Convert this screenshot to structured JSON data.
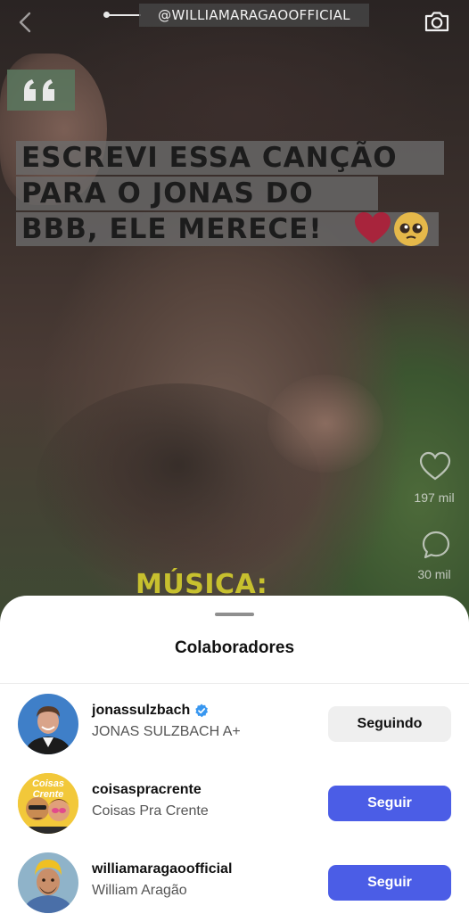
{
  "video": {
    "handle": "@WILLIAMARAGAOOFFICIAL",
    "caption_lines": [
      "ESCREVI ESSA CANÇÃO",
      "PARA O JONAS DO",
      "BBB, ELE MERECE!"
    ],
    "music_text": "MÚSICA: JONAS",
    "likes": "197 mil",
    "comments": "30 mil",
    "icons": {
      "back": "chevron-left-icon",
      "camera": "camera-icon",
      "like": "heart-outline-icon",
      "comment": "speech-bubble-icon",
      "quote": "quote-icon"
    },
    "emojis": [
      "heart-emoji",
      "pleading-face-emoji"
    ]
  },
  "sheet": {
    "title": "Colaboradores",
    "collaborators": [
      {
        "username": "jonassulzbach",
        "display_name": "JONAS SULZBACH A+",
        "verified": true,
        "button": "Seguindo",
        "button_state": "following"
      },
      {
        "username": "coisaspracrente",
        "display_name": "Coisas Pra Crente",
        "verified": false,
        "button": "Seguir",
        "button_state": "follow",
        "avatar_text": "Coisas Crente"
      },
      {
        "username": "williamaragaoofficial",
        "display_name": "William Aragão",
        "verified": false,
        "button": "Seguir",
        "button_state": "follow"
      }
    ]
  },
  "colors": {
    "follow_button": "#4b5de6",
    "following_button": "#efefef",
    "verified": "#3897f0",
    "music_text": "#c7c02e"
  }
}
